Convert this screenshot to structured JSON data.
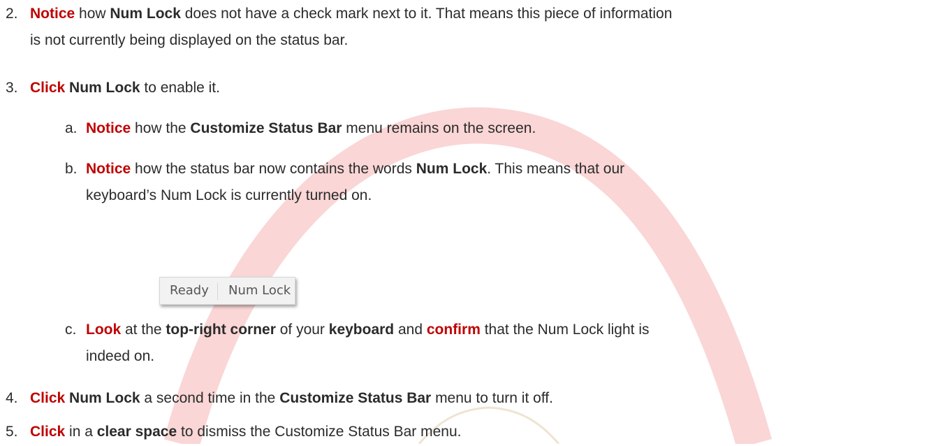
{
  "steps": [
    {
      "number": "2.",
      "lines": [
        [
          {
            "text": "Notice",
            "style": "kw"
          },
          {
            "text": " how ",
            "style": ""
          },
          {
            "text": "Num Lock",
            "style": "b"
          },
          {
            "text": " does not have a check mark next to it.  That means this piece of information",
            "style": ""
          }
        ],
        [
          {
            "text": "is not currently being displayed on the status bar.",
            "style": ""
          }
        ]
      ]
    },
    {
      "number": "3.",
      "lines": [
        [
          {
            "text": "Click",
            "style": "kw"
          },
          {
            "text": " ",
            "style": ""
          },
          {
            "text": "Num Lock",
            "style": "b"
          },
          {
            "text": " to enable it.",
            "style": ""
          }
        ]
      ]
    },
    {
      "number": "a.",
      "lines": [
        [
          {
            "text": "Notice",
            "style": "kw"
          },
          {
            "text": " how the ",
            "style": ""
          },
          {
            "text": "Customize Status Bar",
            "style": "b"
          },
          {
            "text": " menu remains on the screen.",
            "style": ""
          }
        ]
      ]
    },
    {
      "number": "b.",
      "lines": [
        [
          {
            "text": "Notice",
            "style": "kw"
          },
          {
            "text": " how the status bar now contains the words ",
            "style": ""
          },
          {
            "text": "Num Lock",
            "style": "b"
          },
          {
            "text": ".  This means that our",
            "style": ""
          }
        ],
        [
          {
            "text": "keyboard’s Num Lock is currently turned on.",
            "style": ""
          }
        ]
      ]
    },
    {
      "number": "c.",
      "lines": [
        [
          {
            "text": "Look",
            "style": "kw"
          },
          {
            "text": " at the ",
            "style": ""
          },
          {
            "text": "top-right corner",
            "style": "b"
          },
          {
            "text": " of your ",
            "style": ""
          },
          {
            "text": "keyboard",
            "style": "b"
          },
          {
            "text": " and ",
            "style": ""
          },
          {
            "text": "confirm",
            "style": "kw"
          },
          {
            "text": " that the Num Lock light is",
            "style": ""
          }
        ],
        [
          {
            "text": "indeed on.",
            "style": ""
          }
        ]
      ]
    },
    {
      "number": "4.",
      "lines": [
        [
          {
            "text": "Click",
            "style": "kw"
          },
          {
            "text": " ",
            "style": ""
          },
          {
            "text": "Num Lock",
            "style": "b"
          },
          {
            "text": " a second time in the ",
            "style": ""
          },
          {
            "text": "Customize Status Bar",
            "style": "b"
          },
          {
            "text": " menu to turn it off.",
            "style": ""
          }
        ]
      ]
    },
    {
      "number": "5.",
      "lines": [
        [
          {
            "text": "Click",
            "style": "kw"
          },
          {
            "text": " in a ",
            "style": ""
          },
          {
            "text": "clear space",
            "style": "b"
          },
          {
            "text": " to dismiss the Customize Status Bar menu.",
            "style": ""
          }
        ]
      ]
    }
  ],
  "statusbar": {
    "ready": "Ready",
    "numlock": "Num Lock"
  },
  "colors": {
    "keyword": "#c00000",
    "watermark": "#f0a0a0"
  }
}
